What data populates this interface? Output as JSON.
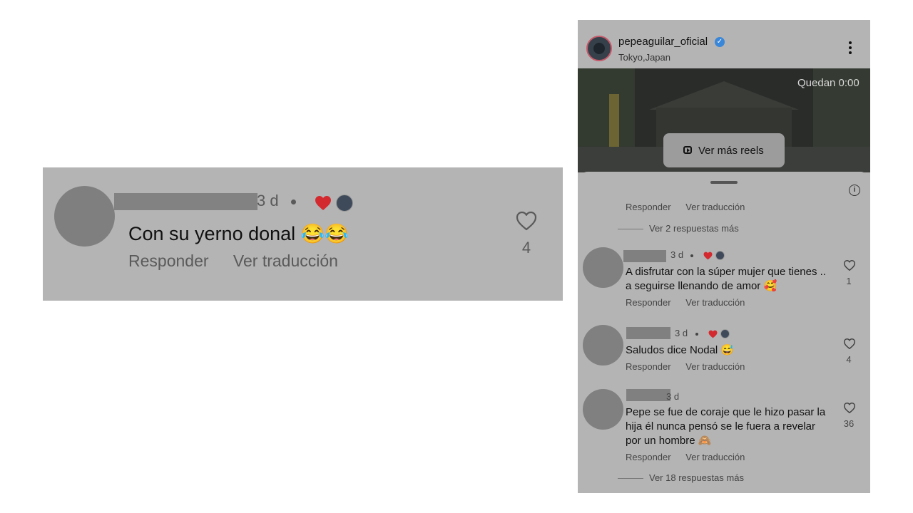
{
  "zoomed_comment": {
    "time": "3 d",
    "text": "Con su yerno donal 😂😂",
    "reply_label": "Responder",
    "translate_label": "Ver traducción",
    "likes": "4"
  },
  "post": {
    "username": "pepeaguilar_oficial",
    "location": "Tokyo,Japan",
    "remaining": "Quedan 0:00",
    "more_reels_label": "Ver más reels"
  },
  "comments_sheet": {
    "top_reply_label": "Responder",
    "top_translate_label": "Ver traducción",
    "top_more_replies": "Ver 2 respuestas más",
    "comments": [
      {
        "time": "3 d",
        "text": "A disfrutar con la súper mujer que tienes .. a seguirse llenando de amor 🥰",
        "reply_label": "Responder",
        "translate_label": "Ver traducción",
        "likes": "1"
      },
      {
        "time": "3 d",
        "text": "Saludos dice Nodal 😅",
        "reply_label": "Responder",
        "translate_label": "Ver traducción",
        "likes": "4"
      },
      {
        "time": "3 d",
        "text": "Pepe se fue de coraje que le hizo pasar la hija él nunca pensó se le fuera a revelar por un hombre 🙈",
        "reply_label": "Responder",
        "translate_label": "Ver traducción",
        "likes": "36"
      }
    ],
    "bottom_more_replies": "Ver 18 respuestas más"
  },
  "colors": {
    "overlay_gray": "#b4b4b4",
    "redaction_gray": "#808080",
    "heart_red": "#d32a2f",
    "verified_blue": "#3a86d8"
  }
}
